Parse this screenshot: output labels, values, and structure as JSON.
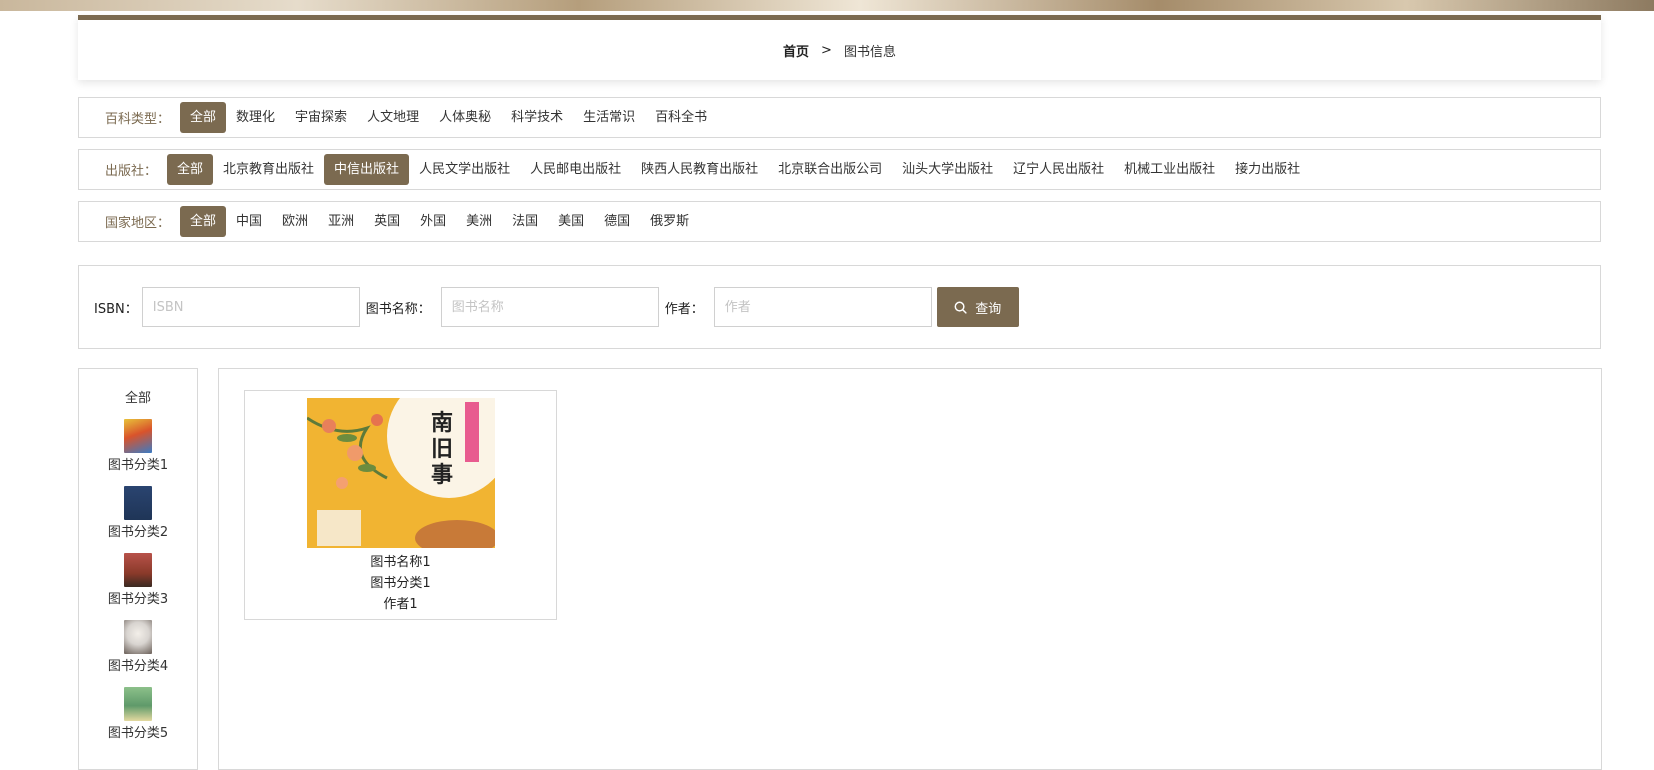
{
  "breadcrumb": {
    "home": "首页",
    "separator": ">",
    "current": "图书信息"
  },
  "filters": [
    {
      "label": "百科类型：",
      "options": [
        "全部",
        "数理化",
        "宇宙探索",
        "人文地理",
        "人体奥秘",
        "科学技术",
        "生活常识",
        "百科全书"
      ],
      "active": [
        0
      ]
    },
    {
      "label": "出版社：",
      "options": [
        "全部",
        "北京教育出版社",
        "中信出版社",
        "人民文学出版社",
        "人民邮电出版社",
        "陕西人民教育出版社",
        "北京联合出版公司",
        "汕头大学出版社",
        "辽宁人民出版社",
        "机械工业出版社",
        "接力出版社"
      ],
      "active": [
        0,
        2
      ]
    },
    {
      "label": "国家地区：",
      "options": [
        "全部",
        "中国",
        "欧洲",
        "亚洲",
        "英国",
        "外国",
        "美洲",
        "法国",
        "美国",
        "德国",
        "俄罗斯"
      ],
      "active": [
        0
      ]
    }
  ],
  "search": {
    "isbn_label": "ISBN：",
    "isbn_placeholder": "ISBN",
    "name_label": "图书名称：",
    "name_placeholder": "图书名称",
    "author_label": "作者：",
    "author_placeholder": "作者",
    "button_label": "查询"
  },
  "sidebar": {
    "all_label": "全部",
    "categories": [
      {
        "name": "图书分类1",
        "color": "#d9532b"
      },
      {
        "name": "图书分类2",
        "color": "#1f3557"
      },
      {
        "name": "图书分类3",
        "color": "#8a3a2a"
      },
      {
        "name": "图书分类4",
        "color": "#d8d4d0"
      },
      {
        "name": "图书分类5",
        "color": "#5f9a6a"
      }
    ]
  },
  "books": [
    {
      "name": "图书名称1",
      "category": "图书分类1",
      "author": "作者1",
      "cover_title": "南旧事"
    }
  ],
  "colors": {
    "accent": "#7b6a50"
  }
}
